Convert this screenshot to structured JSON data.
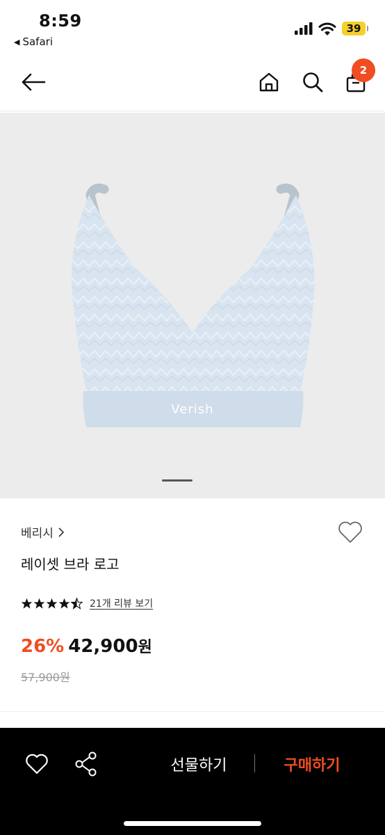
{
  "status_bar": {
    "time": "8:59",
    "back_app": "Safari",
    "battery": "39"
  },
  "header": {
    "cart_count": "2"
  },
  "product": {
    "image_logo_text": "Verish",
    "brand": "베리시",
    "title": "레이셋 브라 로고",
    "rating": 4.5,
    "review_link": "21개 리뷰 보기",
    "discount": "26%",
    "price": "42,900",
    "price_unit": "원",
    "original_price": "57,900원"
  },
  "bottom_bar": {
    "gift_label": "선물하기",
    "buy_label": "구매하기"
  },
  "colors": {
    "accent": "#f04d22",
    "image_bg": "#ececec",
    "bra": "#d8e4ef"
  }
}
